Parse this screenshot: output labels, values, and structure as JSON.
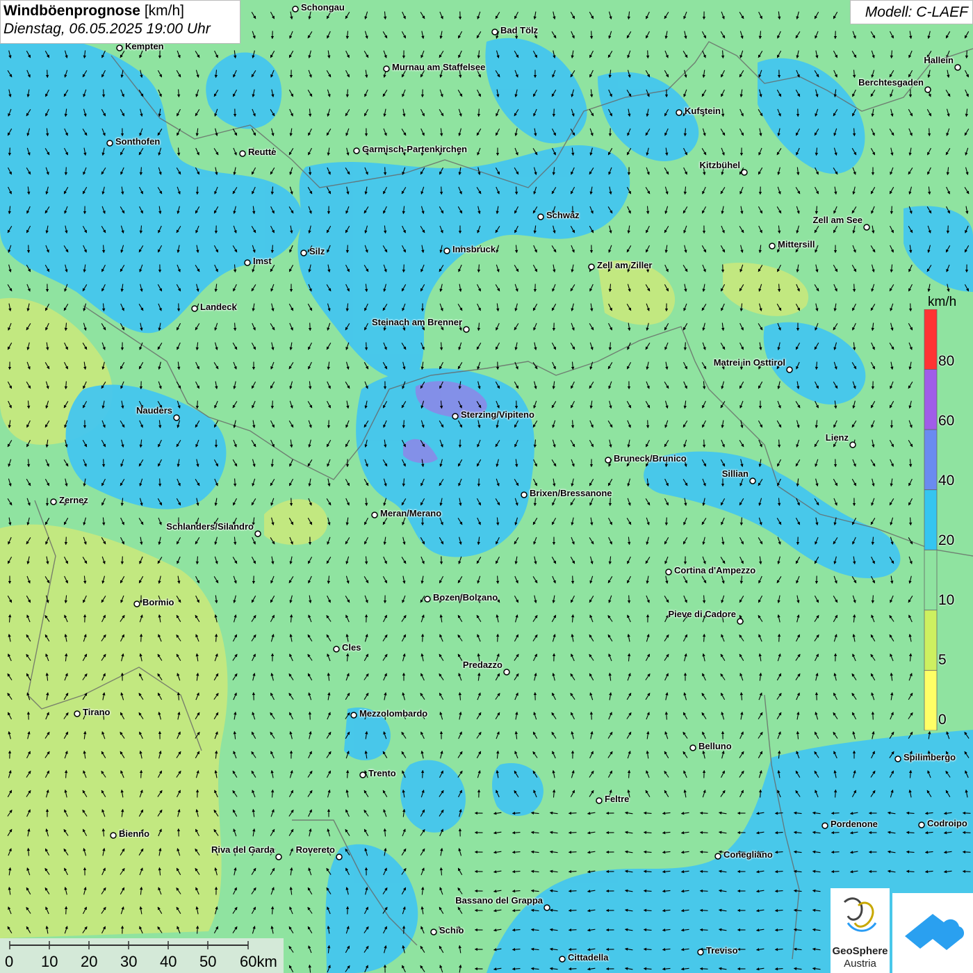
{
  "title": {
    "main": "Windböenprognose",
    "unit": "[km/h]",
    "datetime": "Dienstag, 06.05.2025 19:00 Uhr"
  },
  "model": "Modell: C-LAEF",
  "legend": {
    "unit": "km/h",
    "ticks": [
      "80",
      "60",
      "40",
      "20",
      "10",
      "5",
      "0"
    ],
    "colors": [
      "#ff3333",
      "#a05de8",
      "#6a8bf0",
      "#35c5f0",
      "#8fe3a0",
      "#cdf060",
      "#ffff66"
    ]
  },
  "colors": {
    "calm": "#8fe3a0",
    "moderate": "#45c6ee",
    "strong": "#8a8ae8",
    "light": "#cbe97a"
  },
  "scalebar": {
    "labels": [
      "0",
      "10",
      "20",
      "30",
      "40",
      "50",
      "60km"
    ]
  },
  "logos": {
    "geosphere_line1": "GeoSphere",
    "geosphere_line2": "Austria"
  },
  "cities": [
    {
      "name": "Schongau"
    },
    {
      "name": "Bad Tölz"
    },
    {
      "name": "Kempten"
    },
    {
      "name": "Murnau am Staffelsee"
    },
    {
      "name": "Hallein"
    },
    {
      "name": "Berchtesgaden"
    },
    {
      "name": "Kufstein"
    },
    {
      "name": "Sonthofen"
    },
    {
      "name": "Reutte"
    },
    {
      "name": "Garmisch-Partenkirchen"
    },
    {
      "name": "Kitzbühel"
    },
    {
      "name": "Schwaz"
    },
    {
      "name": "Zell am See"
    },
    {
      "name": "Mittersill"
    },
    {
      "name": "Silz"
    },
    {
      "name": "Innsbruck"
    },
    {
      "name": "Imst"
    },
    {
      "name": "Zell am Ziller"
    },
    {
      "name": "Landeck"
    },
    {
      "name": "Steinach am Brenner"
    },
    {
      "name": "Matrei in Osttirol"
    },
    {
      "name": "Nauders"
    },
    {
      "name": "Sterzing/Vipiteno"
    },
    {
      "name": "Lienz"
    },
    {
      "name": "Bruneck/Brunico"
    },
    {
      "name": "Sillian"
    },
    {
      "name": "Zernez"
    },
    {
      "name": "Brixen/Bressanone"
    },
    {
      "name": "Meran/Merano"
    },
    {
      "name": "Schlanders/Silandro"
    },
    {
      "name": "Cortina d'Ampezzo"
    },
    {
      "name": "Bozen/Bolzano"
    },
    {
      "name": "Bormio"
    },
    {
      "name": "Pieve di Cadore"
    },
    {
      "name": "Cles"
    },
    {
      "name": "Predazzo"
    },
    {
      "name": "Tirano"
    },
    {
      "name": "Mezzolombardo"
    },
    {
      "name": "Belluno"
    },
    {
      "name": "Spilimbergo"
    },
    {
      "name": "Trento"
    },
    {
      "name": "Feltre"
    },
    {
      "name": "Pordenone"
    },
    {
      "name": "Codroipo"
    },
    {
      "name": "Bienno"
    },
    {
      "name": "Riva del Garda"
    },
    {
      "name": "Rovereto"
    },
    {
      "name": "Conegliano"
    },
    {
      "name": "Bassano del Grappa"
    },
    {
      "name": "Schio"
    },
    {
      "name": "Treviso"
    },
    {
      "name": "Cittadella"
    }
  ]
}
